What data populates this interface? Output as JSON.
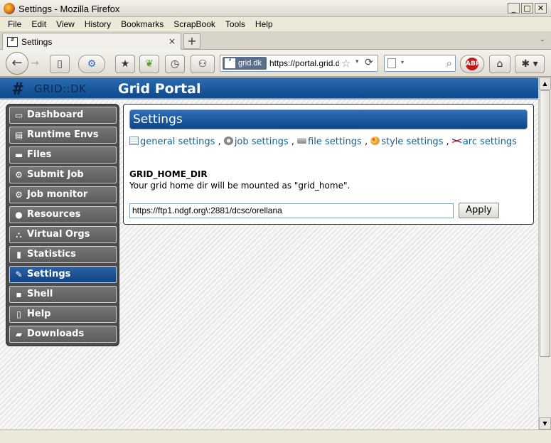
{
  "window": {
    "title": "Settings - Mozilla Firefox",
    "min": "_",
    "max": "□",
    "close": "✕"
  },
  "menubar": [
    "File",
    "Edit",
    "View",
    "History",
    "Bookmarks",
    "ScrapBook",
    "Tools",
    "Help"
  ],
  "tab": {
    "label": "Settings",
    "close": "×",
    "new_tab": "+"
  },
  "nav": {
    "back": "←",
    "forward": "→",
    "site_badge": "grid.dk",
    "url": "https://portal.grid.dk",
    "star": "☆",
    "reload": "⟳",
    "search_icon": "⌕"
  },
  "site": {
    "logo_text": "GRID::DK",
    "logo_mark": "#",
    "title": "Grid Portal"
  },
  "menu": [
    {
      "label": "Dashboard",
      "icon": "▭",
      "icon_name": "dashboard-icon"
    },
    {
      "label": "Runtime Envs",
      "icon": "▤",
      "icon_name": "database-icon"
    },
    {
      "label": "Files",
      "icon": "▬",
      "icon_name": "drive-icon"
    },
    {
      "label": "Submit Job",
      "icon": "⚙",
      "icon_name": "gear-icon"
    },
    {
      "label": "Job monitor",
      "icon": "⚙",
      "icon_name": "gear-icon"
    },
    {
      "label": "Resources",
      "icon": "●",
      "icon_name": "resources-icon"
    },
    {
      "label": "Virtual Orgs",
      "icon": "⛬",
      "icon_name": "network-icon"
    },
    {
      "label": "Statistics",
      "icon": "▮",
      "icon_name": "bar-chart-icon"
    },
    {
      "label": "Settings",
      "icon": "✎",
      "icon_name": "wrench-icon",
      "active": true
    },
    {
      "label": "Shell",
      "icon": "▪",
      "icon_name": "terminal-icon"
    },
    {
      "label": "Help",
      "icon": "▯",
      "icon_name": "document-icon"
    },
    {
      "label": "Downloads",
      "icon": "▰",
      "icon_name": "download-icon"
    }
  ],
  "settings": {
    "heading": "Settings",
    "links": [
      "general settings",
      "job settings",
      "file settings",
      "style settings",
      "arc settings"
    ],
    "separator": ",",
    "field_name": "GRID_HOME_DIR",
    "field_desc": "Your grid home dir will be mounted as \"grid_home\".",
    "field_value": "https://ftp1.ndgf.org\\:2881/dcsc/orellana",
    "apply_label": "Apply"
  },
  "colors": {
    "header_blue": "#0e4687",
    "link": "#1a5e8c",
    "nav_bg": "#4b4b4b",
    "nav_active": "#2d63a6"
  }
}
